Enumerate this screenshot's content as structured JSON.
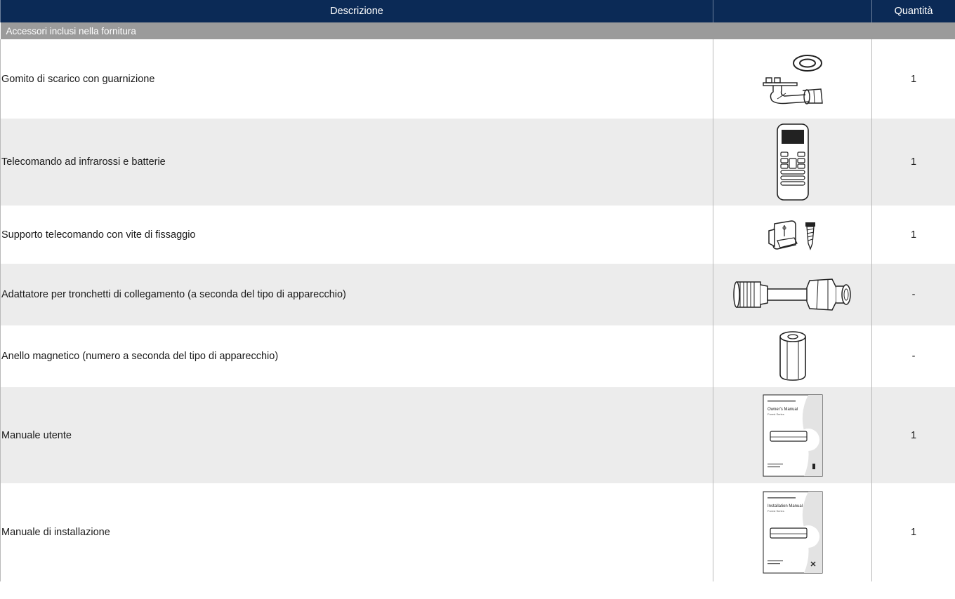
{
  "header": {
    "description": "Descrizione",
    "image_col": "",
    "quantity": "Quantità"
  },
  "section": {
    "title": "Accessori inclusi nella fornitura"
  },
  "rows": [
    {
      "description": "Gomito di scarico con guarnizione",
      "quantity": "1",
      "icon": "drain-elbow-icon"
    },
    {
      "description": "Telecomando ad infrarossi e batterie",
      "quantity": "1",
      "icon": "remote-control-icon"
    },
    {
      "description": "Supporto telecomando con vite di fissaggio",
      "quantity": "1",
      "icon": "remote-holder-icon"
    },
    {
      "description": "Adattatore per tronchetti di collegamento (a seconda del tipo di apparecchio)",
      "quantity": "-",
      "icon": "pipe-adapter-icon"
    },
    {
      "description": "Anello magnetico (numero a seconda del tipo di apparecchio)",
      "quantity": "-",
      "icon": "magnetic-ring-icon"
    },
    {
      "description": "Manuale utente",
      "quantity": "1",
      "icon": "user-manual-icon",
      "cover_title": "Owner's Manual",
      "cover_subtitle": "Forest Series"
    },
    {
      "description": "Manuale di installazione",
      "quantity": "1",
      "icon": "installation-manual-icon",
      "cover_title": "Installation Manual",
      "cover_subtitle": "Forest Series"
    }
  ]
}
